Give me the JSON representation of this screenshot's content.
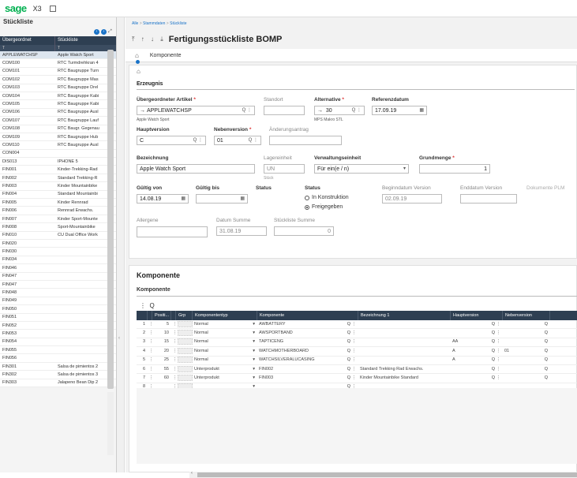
{
  "app": {
    "logo": "sage",
    "product": "X3"
  },
  "left_panel": {
    "title": "Stückliste",
    "col1": "Übergeordnet",
    "col2": "Stückliste",
    "filter1": "T",
    "filter2": "T",
    "rows": [
      [
        "APPLEWATCHSP",
        "Apple Watch Sport"
      ],
      [
        "COM100",
        "RTC Turmdrehkran 4"
      ],
      [
        "COM101",
        "RTC Baugruppe Turn"
      ],
      [
        "COM102",
        "RTC Baugruppe Mas"
      ],
      [
        "COM103",
        "RTC Baugruppe Drel"
      ],
      [
        "COM104",
        "RTC Baugruppe Kabi"
      ],
      [
        "COM105",
        "RTC Baugruppe Kabi"
      ],
      [
        "COM106",
        "RTC Baugruppe Ausl"
      ],
      [
        "COM107",
        "RTC Baugruppe Lauf"
      ],
      [
        "COM108",
        "RTC Baugr. Gegenau"
      ],
      [
        "COM109",
        "RTC Baugruppe Hub"
      ],
      [
        "COM110",
        "RTC Baugruppe Ausl"
      ],
      [
        "CON004",
        ""
      ],
      [
        "DIS013",
        "IPHONE 5"
      ],
      [
        "FIN001",
        "Kinder-Trekking-Rad"
      ],
      [
        "FIN002",
        "Standard Trekking-R"
      ],
      [
        "FIN003",
        "Kinder Mountainbike"
      ],
      [
        "FIN004",
        "Standard Mountainbi"
      ],
      [
        "FIN005",
        "Kinder Rennrad"
      ],
      [
        "FIN006",
        "Rennrad Erwachs."
      ],
      [
        "FIN007",
        "Kinder Sport-Mounte"
      ],
      [
        "FIN008",
        "Sport-Mountainbike"
      ],
      [
        "FIN010",
        "CU Dual Office Work"
      ],
      [
        "FIN020",
        ""
      ],
      [
        "FIN030",
        ""
      ],
      [
        "FIN034",
        ""
      ],
      [
        "FIN046",
        ""
      ],
      [
        "FIN047",
        ""
      ],
      [
        "FIN047",
        ""
      ],
      [
        "FIN048",
        ""
      ],
      [
        "FIN049",
        ""
      ],
      [
        "FIN050",
        ""
      ],
      [
        "FIN051",
        ""
      ],
      [
        "FIN052",
        ""
      ],
      [
        "FIN053",
        ""
      ],
      [
        "FIN054",
        ""
      ],
      [
        "FIN055",
        ""
      ],
      [
        "FIN056",
        ""
      ],
      [
        "FIN301",
        "Salsa de pimientos 2"
      ],
      [
        "FIN302",
        "Salsa de pimientos 3"
      ],
      [
        "FIN303",
        "Jalapeno Bean Dip 2"
      ]
    ]
  },
  "breadcrumb": {
    "root": "Alle",
    "sep1": ">",
    "mid": "Stammdaten",
    "sep2": ">",
    "leaf": "Stückliste"
  },
  "page": {
    "title": "Fertigungsstückliste BOMP",
    "arrows": "⤒ ↑ ↓ ⤓"
  },
  "tabs": {
    "komponente": "Komponente"
  },
  "form": {
    "section": "Erzeugnis",
    "parent_label": "Übergeordneter Artikel",
    "parent_value": "APPLEWATCHSP",
    "parent_desc": "Apple Watch Sport",
    "site_label": "Standort",
    "alt_label": "Alternative",
    "alt_value": "30",
    "alt_desc": "MPS Makro STL",
    "refdate_label": "Referenzdatum",
    "refdate_value": "17.09.19",
    "mainver_label": "Hauptversion",
    "mainver_value": "C",
    "subver_label": "Nebenversion",
    "subver_value": "01",
    "change_label": "Änderungsantrag",
    "desc_label": "Bezeichnung",
    "desc_value": "Apple Watch Sport",
    "stockunit_label": "Lagereinheit",
    "stockunit_value": "UN",
    "stockunit_sub": "Stück",
    "admunit_label": "Verwaltungseinheit",
    "admunit_value": "Für ein(e / n)",
    "basequant_label": "Grundmenge",
    "basequant_value": "1",
    "validfrom_label": "Gültig von",
    "validfrom_value": "14.08.19",
    "validto_label": "Gültig bis",
    "status1_label": "Status",
    "status2_label": "Status",
    "radio1": "In Konstruktion",
    "radio2": "Freigegeben",
    "startver_label": "Beginndatum Version",
    "startver_value": "02.09.19",
    "endver_label": "Enddatum Version",
    "plm_label": "Dokumente PLM",
    "allergen_label": "Allergene",
    "sumdate_label": "Datum Summe",
    "sumdate_value": "31.08.19",
    "sumbom_label": "Stückliste Summe",
    "sumbom_value": "0"
  },
  "components": {
    "title": "Komponente",
    "subtitle": "Komponente",
    "headers": [
      "",
      "",
      "Positi...",
      "",
      "Grp",
      "Komponententyp",
      "Komponente",
      "Bezeichnung 1",
      "Hauptversion",
      "Nebenversion"
    ],
    "rows": [
      {
        "n": "1",
        "pos": "5",
        "type": "Normal",
        "comp": "AWBATTERY",
        "desc": "",
        "main": "",
        "sub": ""
      },
      {
        "n": "2",
        "pos": "10",
        "type": "Normal",
        "comp": "AWSPORTBAND",
        "desc": "",
        "main": "",
        "sub": ""
      },
      {
        "n": "3",
        "pos": "15",
        "type": "Normal",
        "comp": "TAPTICENG",
        "desc": "",
        "main": "AA",
        "sub": ""
      },
      {
        "n": "4",
        "pos": "20",
        "type": "Normal",
        "comp": "WATCHMOTHERBOARD",
        "desc": "",
        "main": "A",
        "sub": "01"
      },
      {
        "n": "5",
        "pos": "25",
        "type": "Normal",
        "comp": "WATCHSILVERALUCASING",
        "desc": "",
        "main": "A",
        "sub": ""
      },
      {
        "n": "6",
        "pos": "55",
        "type": "Unterprodukt",
        "comp": "FIN002",
        "desc": "Standard Trekking Rad Erwachs.",
        "main": "",
        "sub": ""
      },
      {
        "n": "7",
        "pos": "60",
        "type": "Unterprodukt",
        "comp": "FIN003",
        "desc": "Kinder Mountainbike Standard",
        "main": "",
        "sub": ""
      },
      {
        "n": "8",
        "pos": "",
        "type": "",
        "comp": "",
        "desc": "",
        "main": "",
        "sub": ""
      }
    ]
  }
}
